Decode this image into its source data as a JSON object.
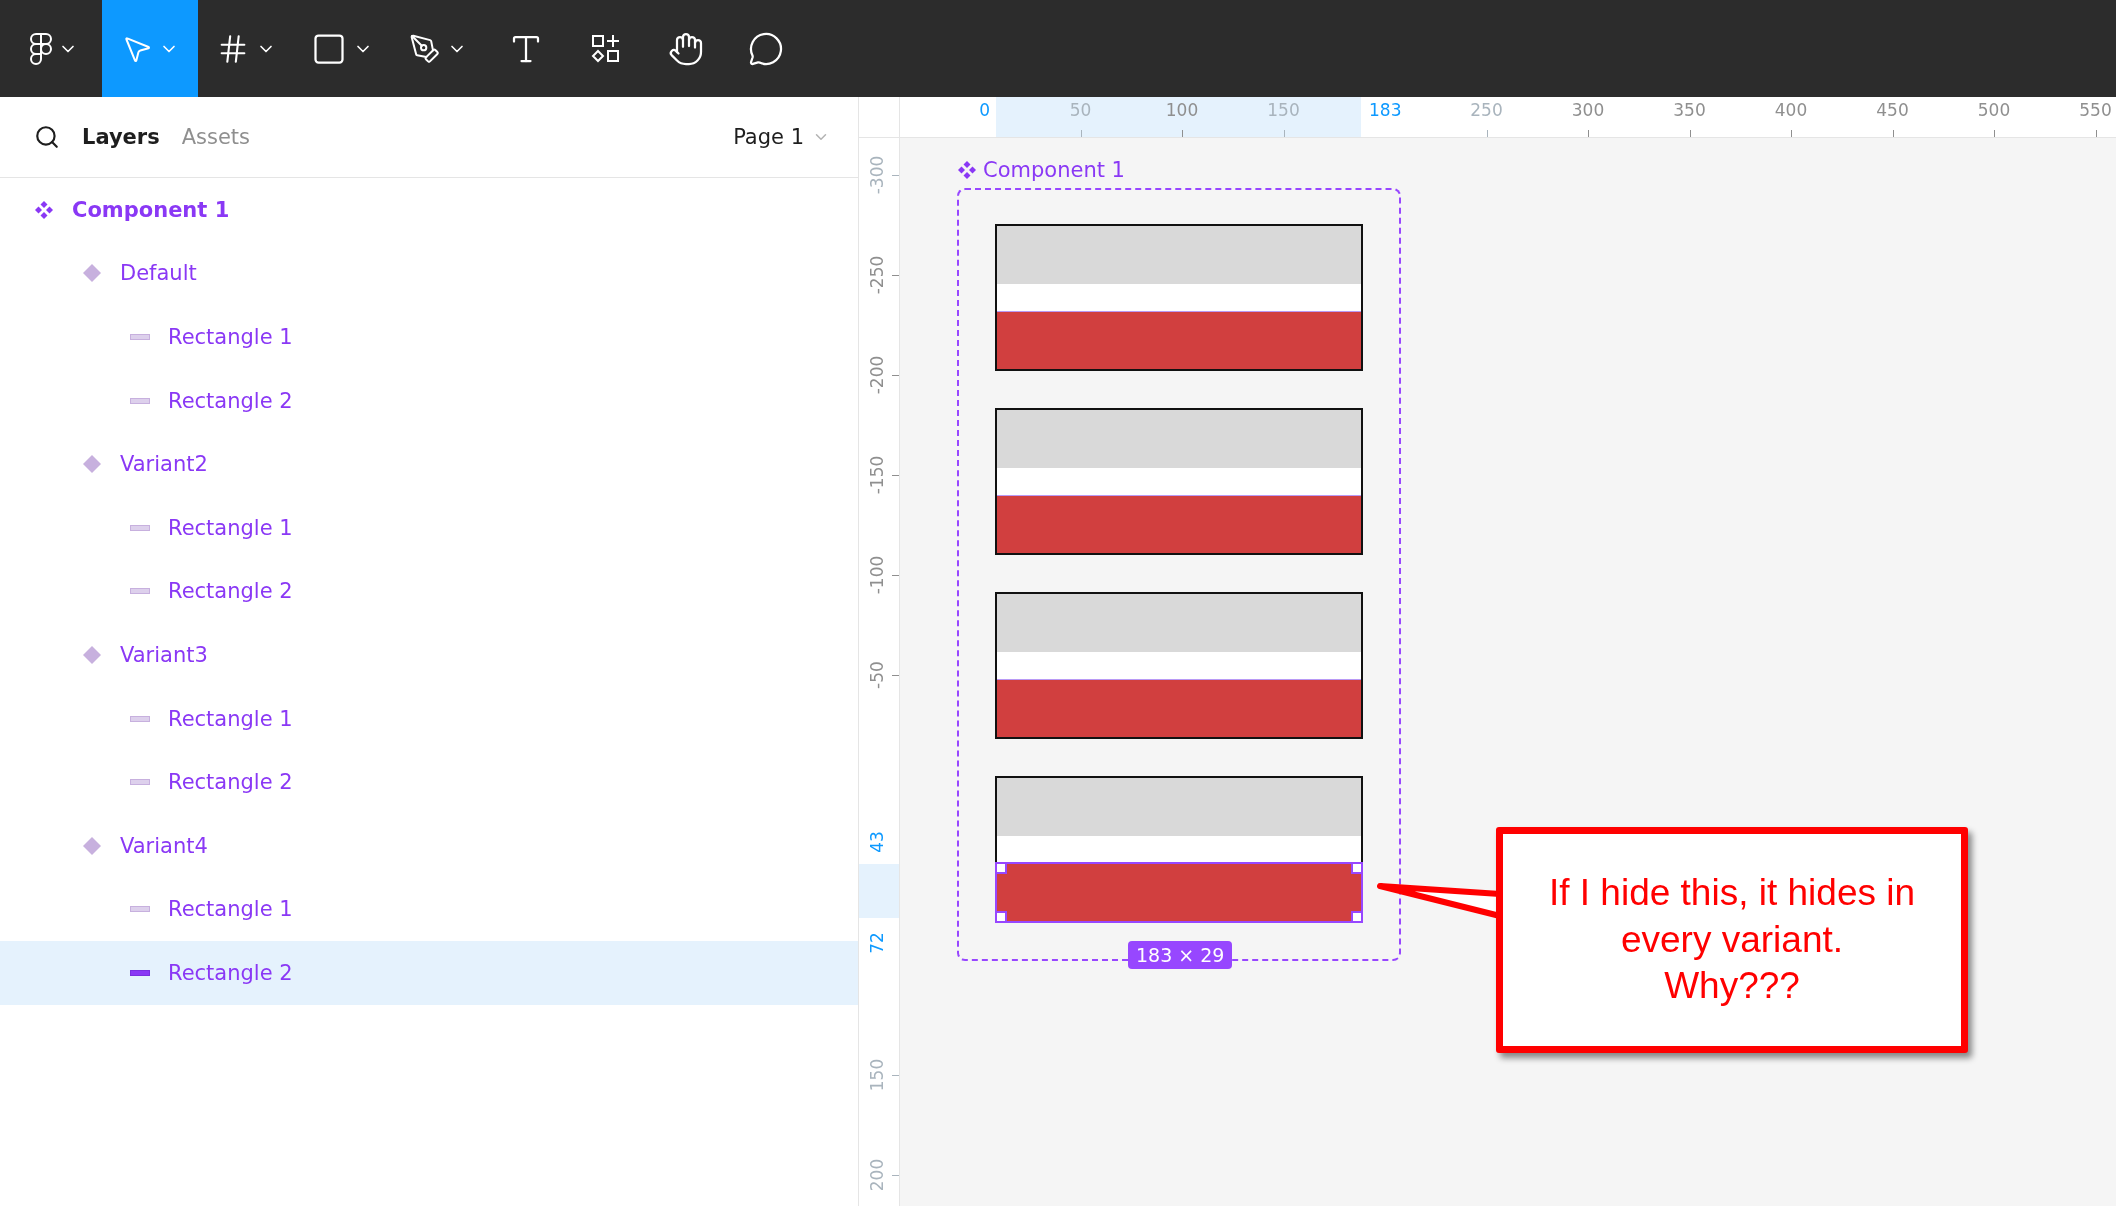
{
  "toolbar": {
    "tools": [
      {
        "kind": "logo",
        "dropdown": true,
        "selected": false
      },
      {
        "kind": "select",
        "dropdown": true,
        "selected": true
      },
      {
        "kind": "frame",
        "dropdown": true,
        "selected": false
      },
      {
        "kind": "rectangle",
        "dropdown": true,
        "selected": false
      },
      {
        "kind": "pen",
        "dropdown": true,
        "selected": false
      },
      {
        "kind": "text",
        "dropdown": false,
        "selected": false
      },
      {
        "kind": "resources",
        "dropdown": false,
        "selected": false
      },
      {
        "kind": "hand",
        "dropdown": false,
        "selected": false
      },
      {
        "kind": "comment",
        "dropdown": false,
        "selected": false
      }
    ]
  },
  "panel": {
    "tabs": [
      {
        "label": "Layers",
        "selected": true
      },
      {
        "label": "Assets",
        "selected": false
      }
    ],
    "page": "Page 1"
  },
  "layers": [
    {
      "name": "Component 1",
      "kind": "component",
      "selected": false,
      "children": [
        {
          "name": "Default",
          "kind": "variant",
          "selected": false,
          "children": [
            {
              "name": "Rectangle 1",
              "kind": "rectangle",
              "selected": false
            },
            {
              "name": "Rectangle 2",
              "kind": "rectangle",
              "selected": false
            }
          ]
        },
        {
          "name": "Variant2",
          "kind": "variant",
          "selected": false,
          "children": [
            {
              "name": "Rectangle 1",
              "kind": "rectangle",
              "selected": false
            },
            {
              "name": "Rectangle 2",
              "kind": "rectangle",
              "selected": false
            }
          ]
        },
        {
          "name": "Variant3",
          "kind": "variant",
          "selected": false,
          "children": [
            {
              "name": "Rectangle 1",
              "kind": "rectangle",
              "selected": false
            },
            {
              "name": "Rectangle 2",
              "kind": "rectangle",
              "selected": false
            }
          ]
        },
        {
          "name": "Variant4",
          "kind": "variant",
          "selected": false,
          "children": [
            {
              "name": "Rectangle 1",
              "kind": "rectangle",
              "selected": false
            },
            {
              "name": "Rectangle 2",
              "kind": "rectangle",
              "selected": true
            }
          ]
        }
      ]
    }
  ],
  "rulers": {
    "top": [
      {
        "label": "0",
        "kind": "marker"
      },
      {
        "label": "50",
        "kind": "faint"
      },
      {
        "label": "100",
        "kind": "normal"
      },
      {
        "label": "150",
        "kind": "faint"
      },
      {
        "label": "183",
        "kind": "marker"
      },
      {
        "label": "250",
        "kind": "faint"
      },
      {
        "label": "300",
        "kind": "normal"
      },
      {
        "label": "350",
        "kind": "normal"
      },
      {
        "label": "400",
        "kind": "normal"
      },
      {
        "label": "450",
        "kind": "normal"
      },
      {
        "label": "500",
        "kind": "normal"
      },
      {
        "label": "550",
        "kind": "normal"
      }
    ],
    "left": [
      {
        "label": "-300",
        "kind": "faint"
      },
      {
        "label": "-250",
        "kind": "normal"
      },
      {
        "label": "-200",
        "kind": "normal"
      },
      {
        "label": "-150",
        "kind": "normal"
      },
      {
        "label": "-100",
        "kind": "normal"
      },
      {
        "label": "-50",
        "kind": "normal"
      },
      {
        "label": "43",
        "kind": "marker"
      },
      {
        "label": "72",
        "kind": "marker"
      },
      {
        "label": "150",
        "kind": "faint"
      },
      {
        "label": "200",
        "kind": "faint"
      }
    ]
  },
  "canvas": {
    "component_label": "Component 1",
    "variants": [
      {
        "bottom_selected": false
      },
      {
        "bottom_selected": false
      },
      {
        "bottom_selected": false
      },
      {
        "bottom_selected": true
      }
    ],
    "size_badge": "183 × 29",
    "callout": {
      "text": "If I hide this, it hides in\nevery variant.\nWhy???"
    }
  }
}
